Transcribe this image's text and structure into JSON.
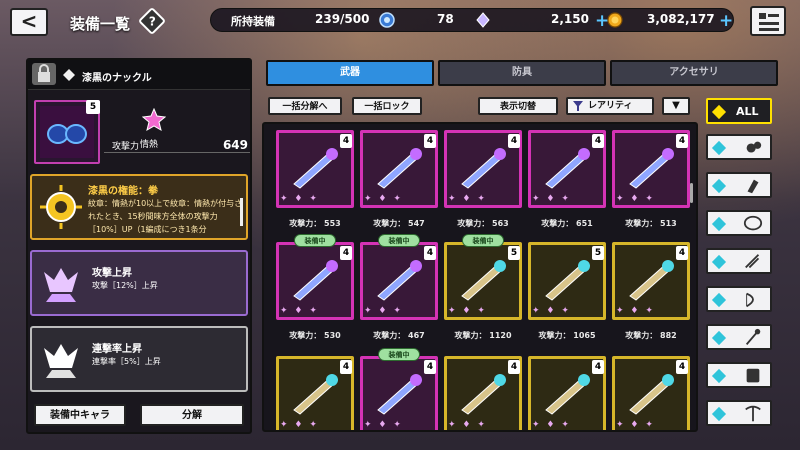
{
  "header": {
    "back_label": "<",
    "title": "装備一覧",
    "help_label": "?",
    "owned_label": "所持装備",
    "owned_value": "239/500",
    "currency_1": "78",
    "currency_2": "2,150",
    "currency_3": "3,082,177",
    "plus": "+"
  },
  "detail": {
    "item_name": "漆黒のナックル",
    "level": "5",
    "element": "情熱",
    "atk_label": "攻撃力",
    "atk_value": "649",
    "skill1_title": "漆黒の権能：拳",
    "skill1_desc": "紋章：情熱が10以上で紋章：情熱が付与されたとき、15秒間味方全体の攻撃力［10%］UP（1編成につき1条分",
    "skill2_title": "攻撃上昇",
    "skill2_desc": "攻撃［12%］上昇",
    "skill3_title": "連撃率上昇",
    "skill3_desc": "連撃率［5%］上昇",
    "equipped_chara_button": "装備中キャラ",
    "disassemble_button": "分解"
  },
  "tabs": [
    "武器",
    "防具",
    "アクセサリ"
  ],
  "toolbar": {
    "bulk_disassemble": "一括分解へ",
    "bulk_lock": "一括ロック",
    "toggle_display": "表示切替",
    "sort_value": "レアリティ",
    "sort_arrow": "▼"
  },
  "grid": {
    "equipped_badge": "装備中",
    "atk_prefix": "攻撃力：",
    "rows": [
      [
        {
          "lvl": "4",
          "frame": "mag",
          "atk": "553",
          "equipped": false
        },
        {
          "lvl": "4",
          "frame": "mag",
          "atk": "547",
          "equipped": false
        },
        {
          "lvl": "4",
          "frame": "mag",
          "atk": "563",
          "equipped": false
        },
        {
          "lvl": "4",
          "frame": "mag",
          "atk": "651",
          "equipped": false
        },
        {
          "lvl": "4",
          "frame": "mag",
          "atk": "513",
          "equipped": false
        }
      ],
      [
        {
          "lvl": "4",
          "frame": "mag",
          "atk": "530",
          "equipped": true
        },
        {
          "lvl": "4",
          "frame": "mag",
          "atk": "467",
          "equipped": true
        },
        {
          "lvl": "5",
          "frame": "gold",
          "atk": "1120",
          "equipped": true
        },
        {
          "lvl": "5",
          "frame": "gold",
          "atk": "1065",
          "equipped": false
        },
        {
          "lvl": "4",
          "frame": "gold",
          "atk": "882",
          "equipped": false
        }
      ],
      [
        {
          "lvl": "4",
          "frame": "gold",
          "atk": "",
          "equipped": false
        },
        {
          "lvl": "4",
          "frame": "mag",
          "atk": "",
          "equipped": true
        },
        {
          "lvl": "4",
          "frame": "gold",
          "atk": "",
          "equipped": false
        },
        {
          "lvl": "4",
          "frame": "gold",
          "atk": "",
          "equipped": false
        },
        {
          "lvl": "4",
          "frame": "gold",
          "atk": "",
          "equipped": false
        }
      ]
    ]
  },
  "filters": {
    "all_label": "ALL",
    "icons": [
      "all",
      "knuckle-icon",
      "flask-icon",
      "shield-icon",
      "claw-icon",
      "bow-icon",
      "staff-icon",
      "tome-icon",
      "pickaxe-icon"
    ]
  },
  "colors": {
    "active_tab": "#2f8fe0",
    "mythic_frame": "#d433b5",
    "legend_frame": "#d6b62a",
    "equipped_badge": "#9fe0a0",
    "filter_all_border": "#ffe000",
    "filter_diamond": "#2fc4da"
  }
}
